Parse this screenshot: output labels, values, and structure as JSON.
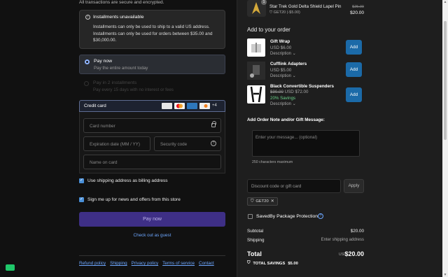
{
  "payment": {
    "secure_text": "All transactions are secure and encrypted.",
    "installments": {
      "title": "Installments unavailable",
      "line1": "Installments can only be used to ship to a valid US address.",
      "line2": "Installments can only be used for orders between $35.00 and",
      "line3": "$30,000.00."
    },
    "pay_now": {
      "title": "Pay now",
      "subtitle": "Pay the entire amount today"
    },
    "pay_two": {
      "title": "Pay in 2 installments",
      "subtitle": "Pay every 15 days with no interest or fees"
    },
    "credit_card": {
      "label": "Credit card",
      "more_cards": "+4",
      "card_colors": {
        "visa": "#e6e6e6",
        "mastercard": "#f4f4f4",
        "amex": "#2e77bc",
        "discover": "#f0f0f0"
      },
      "number_placeholder": "Card number",
      "expiry_placeholder": "Expiration date (MM / YY)",
      "security_placeholder": "Security code",
      "name_placeholder": "Name on card"
    },
    "billing_same_label": "Use shipping address as billing address",
    "news_label": "Sign me up for news and offers from this store",
    "pay_button": "Pay now",
    "guest_link": "Check out as guest",
    "footer_links": [
      "Refund policy",
      "Shipping",
      "Privacy policy",
      "Terms of service",
      "Contact"
    ]
  },
  "order": {
    "top_item": {
      "qty": "1",
      "name": "Star Trek Gold Delta Shield Lapel Pin",
      "discount": "GET20 (-$5.00)",
      "old_price": "$25.00",
      "price": "$20.00"
    },
    "add_title": "Add to your order",
    "upsells": [
      {
        "name": "Gift Wrap",
        "price": "USD $6.00",
        "desc": "Description",
        "btn": "Add"
      },
      {
        "name": "Cufflink Adapters",
        "price": "USD $5.00",
        "desc": "Description",
        "btn": "Add"
      },
      {
        "name": "Black Convertible Suspenders",
        "old_price": "$90.00",
        "price": "USD $72.00",
        "savings": "20% Savings",
        "desc": "Description",
        "btn": "Add"
      }
    ],
    "note": {
      "title": "Add Order Note and/or Gift Message:",
      "placeholder": "Enter your message... (optional)",
      "count": "250 characters maximum"
    },
    "discount_placeholder": "Discount code or gift card",
    "apply_label": "Apply",
    "applied_code": "GET20",
    "protection_label": "SavedBy Package Protection",
    "subtotal_label": "Subtotal",
    "subtotal_value": "$20.00",
    "shipping_label": "Shipping",
    "shipping_value": "Enter shipping address",
    "total_label": "Total",
    "total_currency": "USD",
    "total_value": "$20.00",
    "savings_label": "TOTAL SAVINGS",
    "savings_value": "$5.00"
  }
}
